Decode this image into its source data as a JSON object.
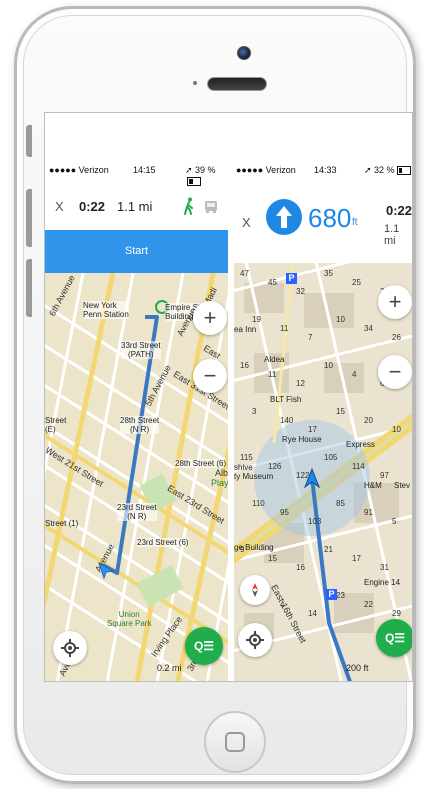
{
  "left": {
    "status": {
      "carrier": "●●●●● Verizon",
      "time": "14:15",
      "battery": "39 %"
    },
    "header": {
      "close": "X",
      "duration": "0:22",
      "distance": "1.1 mi"
    },
    "start_button": "Start",
    "map_labels": {
      "penn": "New York\nPenn Station",
      "empire": "Empire State\nBuilding",
      "st33": "33rd Street\n(PATH)",
      "st28nr": "28th Street\n(N R)",
      "st28_6": "28th Street (6)",
      "st23nr": "23rd Street\n(N R)",
      "st23_6": "23rd Street (6)",
      "street_e": "Street\n(E)",
      "street_1": "Street (1)",
      "union": "Union\nSquare Park",
      "ave6": "6th Avenue",
      "ave5": "5th Avenue",
      "w21": "West 21st Street",
      "e31": "East 31st Street",
      "e23": "East 23rd Street",
      "irving": "Irving Place",
      "ave3": "3rd Avenue",
      "ave": "Avenue",
      "ave_lower": "Avenue",
      "ave_top": "Avenue",
      "madi": "Madi",
      "east": "East",
      "alb": "Alb",
      "play": "Playg"
    },
    "scale": "0.2 mi",
    "colors": {
      "start_bar": "#2f94ea",
      "route": "#3b78c4",
      "walk_icon": "#1fae4b"
    }
  },
  "right": {
    "status": {
      "carrier": "●●●●● Verizon",
      "time": "14:33",
      "battery": "32 %"
    },
    "header": {
      "close": "X",
      "distance_value": "680",
      "distance_unit": "ft",
      "duration": "0:22",
      "distance": "1.1 mi"
    },
    "map_labels": {
      "inn": "ea Inn",
      "aldea": "Aldea",
      "blt": "BLT Fish",
      "rye": "Rye House",
      "express": "Express",
      "hm": "H&M",
      "stev": "Stev",
      "shive": "shive\nty Museum",
      "building": "ge Building",
      "engine": "Engine 14",
      "east16": "East 16th Street",
      "sign": "S"
    },
    "numbers": [
      "47",
      "45",
      "32",
      "35",
      "25",
      "22",
      "19",
      "11",
      "7",
      "10",
      "34",
      "26",
      "16",
      "11",
      "12",
      "10",
      "4",
      "6",
      "3",
      "140",
      "17",
      "15",
      "20",
      "10",
      "115",
      "126",
      "122",
      "105",
      "114",
      "97",
      "110",
      "95",
      "103",
      "85",
      "91",
      "5",
      "9",
      "15",
      "16",
      "21",
      "17",
      "31",
      "13",
      "4",
      "14",
      "23",
      "22",
      "29"
    ],
    "scale": "200 ft",
    "colors": {
      "arrow_circle": "#1e88e5",
      "route": "#3b78c4",
      "green_btn": "#1fae4b"
    }
  },
  "compass_icon": "compass-icon",
  "menu_icon": "list-icon"
}
